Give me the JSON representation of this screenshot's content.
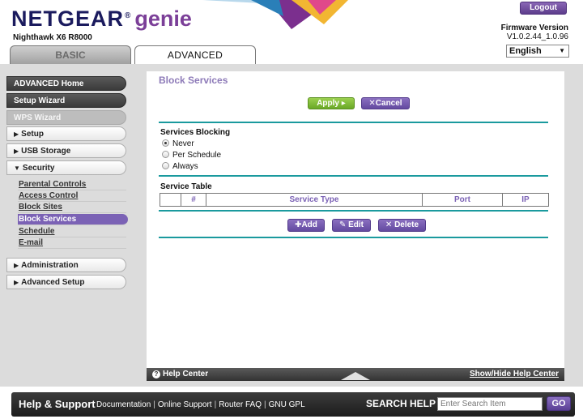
{
  "header": {
    "brand": "NETGEAR",
    "brand_suffix": "genie",
    "registered": "®",
    "model": "Nighthawk X6 R8000",
    "logout_label": "Logout",
    "firmware_label": "Firmware Version",
    "firmware_value": "V1.0.2.44_1.0.96",
    "language": "English",
    "tabs": [
      {
        "label": "BASIC",
        "active": false
      },
      {
        "label": "ADVANCED",
        "active": true
      }
    ]
  },
  "sidebar": {
    "top_items": [
      {
        "label": "ADVANCED Home"
      },
      {
        "label": "Setup Wizard"
      },
      {
        "label": "WPS Wizard"
      }
    ],
    "sections": [
      {
        "label": "Setup",
        "expanded": false
      },
      {
        "label": "USB Storage",
        "expanded": false
      },
      {
        "label": "Security",
        "expanded": true
      },
      {
        "label": "Administration",
        "expanded": false
      },
      {
        "label": "Advanced Setup",
        "expanded": false
      }
    ],
    "security_items": [
      {
        "label": "Parental Controls"
      },
      {
        "label": "Access Control"
      },
      {
        "label": "Block Sites"
      },
      {
        "label": "Block Services",
        "active": true
      },
      {
        "label": "Schedule"
      },
      {
        "label": "E-mail"
      }
    ]
  },
  "main": {
    "title": "Block Services",
    "apply_label": "Apply ▸",
    "cancel_label": "✕Cancel",
    "blocking_label": "Services Blocking",
    "options": [
      {
        "label": "Never",
        "checked": true
      },
      {
        "label": "Per Schedule",
        "checked": false
      },
      {
        "label": "Always",
        "checked": false
      }
    ],
    "table_label": "Service Table",
    "columns": [
      "",
      "#",
      "Service Type",
      "Port",
      "IP"
    ],
    "add_label": "✚Add",
    "edit_label": "✎ Edit",
    "delete_label": "✕ Delete"
  },
  "help_bar": {
    "help_center": "Help Center",
    "toggle": "Show/Hide Help Center"
  },
  "footer": {
    "title": "Help & Support",
    "links": [
      "Documentation",
      "Online Support",
      "Router FAQ",
      "GNU GPL"
    ],
    "search_label": "SEARCH HELP",
    "search_placeholder": "Enter Search Item",
    "go_label": "GO"
  },
  "colors": {
    "accent_purple": "#7b62b5",
    "apply_green": "#6aa826",
    "rule_teal": "#1a9a9e",
    "title_lavender": "#8d7ab8"
  }
}
